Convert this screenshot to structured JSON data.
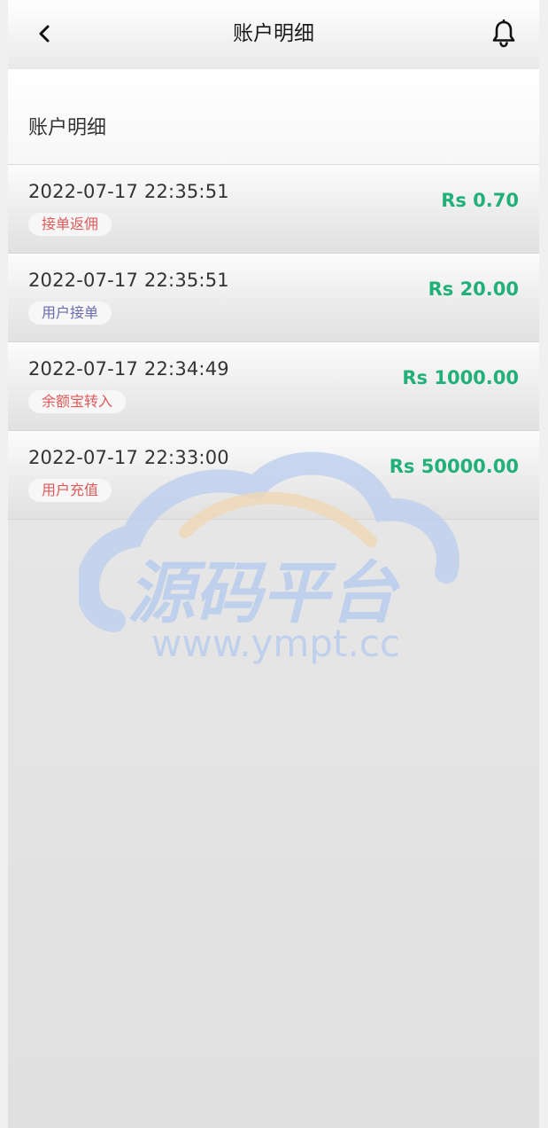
{
  "header": {
    "title": "账户明细",
    "back_icon": "chevron-left-icon",
    "notification_icon": "bell-icon"
  },
  "section": {
    "title": "账户明细"
  },
  "records": [
    {
      "time": "2022-07-17 22:35:51",
      "tag": "接单返佣",
      "tag_color": "#e05a5a",
      "amount": "Rs 0.70"
    },
    {
      "time": "2022-07-17 22:35:51",
      "tag": "用户接单",
      "tag_color": "#6b6bb0",
      "amount": "Rs 20.00"
    },
    {
      "time": "2022-07-17 22:34:49",
      "tag": "余额宝转入",
      "tag_color": "#e05a5a",
      "amount": "Rs 1000.00"
    },
    {
      "time": "2022-07-17 22:33:00",
      "tag": "用户充值",
      "tag_color": "#e05a5a",
      "amount": "Rs 50000.00"
    }
  ],
  "colors": {
    "amount": "#22b07a",
    "tag_red": "#e05a5a",
    "tag_purple": "#6b6bb0"
  },
  "watermark": {
    "title": "源码平台",
    "url": "www.ympt.cc"
  }
}
